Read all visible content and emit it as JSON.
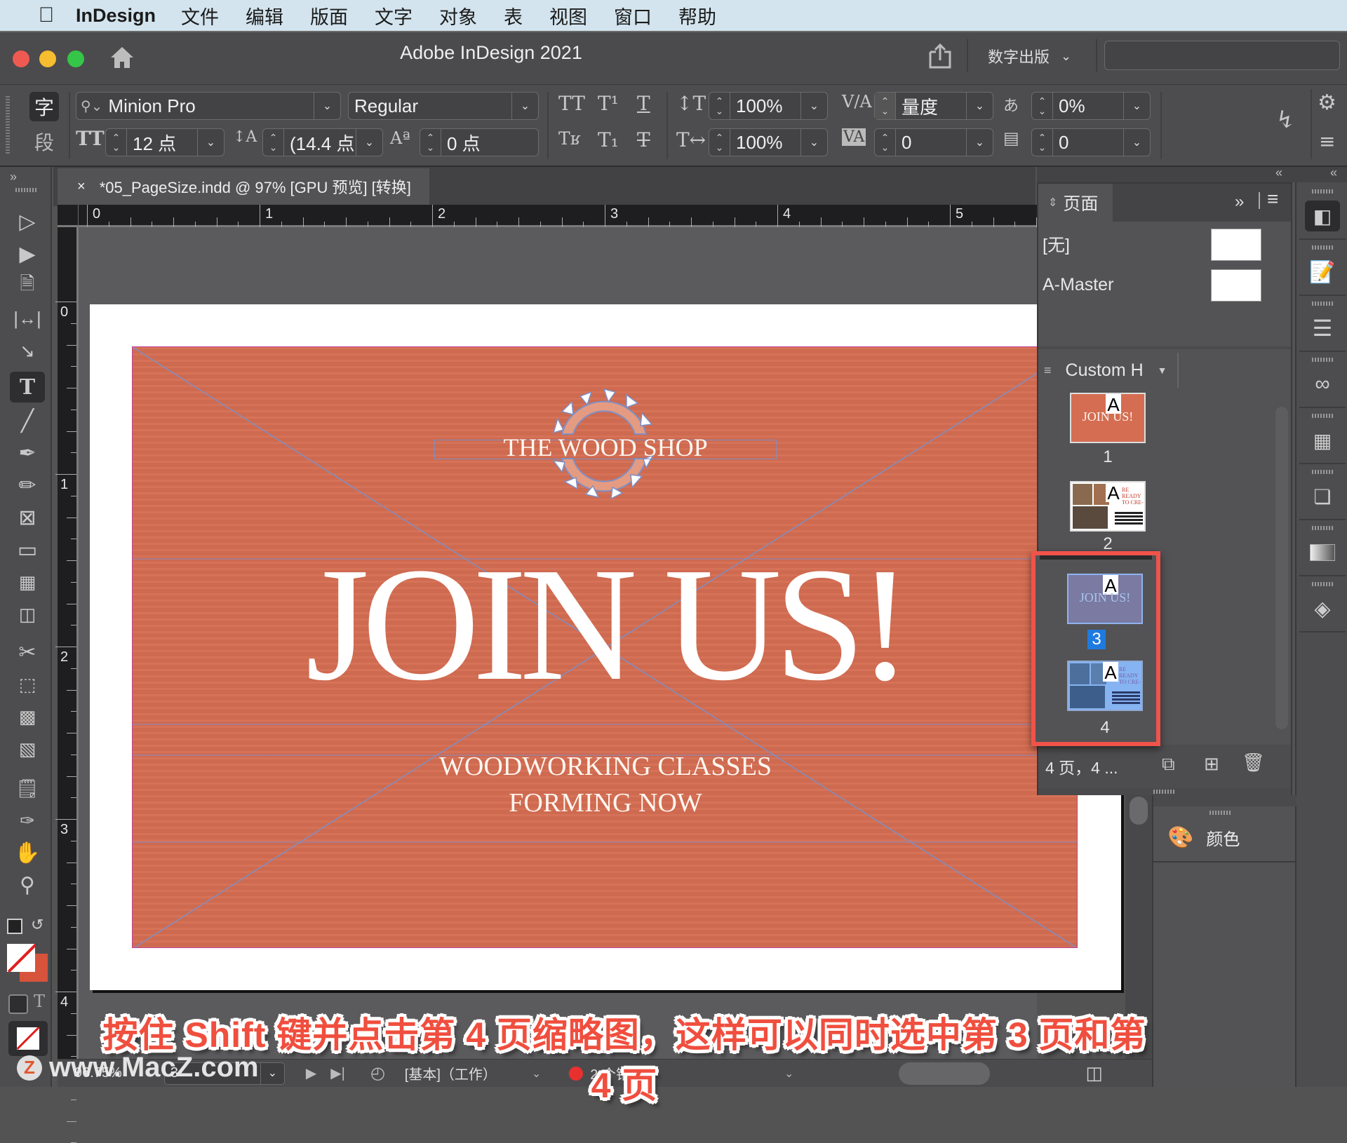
{
  "menubar": {
    "app_name": "InDesign",
    "items": [
      "文件",
      "编辑",
      "版面",
      "文字",
      "对象",
      "表",
      "视图",
      "窗口",
      "帮助"
    ]
  },
  "window": {
    "title": "Adobe InDesign 2021",
    "workspace": "数字出版",
    "search_placeholder": ""
  },
  "controlbar": {
    "mode_char": "字",
    "mode_para": "段",
    "font_family": "Minion Pro",
    "font_style": "Regular",
    "font_size": "12 点",
    "leading": "(14.4 点",
    "baseline_shift": "0 点",
    "vertical_scale": "100%",
    "horizontal_scale": "100%",
    "kerning": "量度",
    "tracking": "0",
    "tsume": "0%",
    "grid_count": "0"
  },
  "document": {
    "tab_title": "*05_PageSize.indd @ 97% [GPU 预览] [转换]",
    "close_glyph": "×",
    "hruler_labels": [
      "0",
      "1",
      "2",
      "3",
      "4",
      "5"
    ],
    "vruler_labels": [
      "0",
      "1",
      "2",
      "3",
      "4"
    ],
    "artwork": {
      "logo_text": "THE WOOD SHOP",
      "headline": "JOIN US!",
      "sub_line1": "WOODWORKING CLASSES",
      "sub_line2": "FORMING NOW",
      "bg_color": "#d56d52"
    }
  },
  "pages_panel": {
    "tab_label": "页面",
    "masters": [
      {
        "label": "[无]"
      },
      {
        "label": "A-Master"
      }
    ],
    "size_select": "Custom H",
    "pages": [
      {
        "number": "1",
        "master": "A",
        "content": "JOIN US!",
        "selected": false
      },
      {
        "number": "2",
        "master": "A",
        "content": "RE READY TO CRE-",
        "selected": false
      },
      {
        "number": "3",
        "master": "A",
        "content": "JOIN US!",
        "selected": true
      },
      {
        "number": "4",
        "master": "A",
        "content": "RE READY TO CRE-",
        "selected": true
      }
    ],
    "footer_status": "4 页，4 ...",
    "highlight_color": "#f0534a"
  },
  "color_panel": {
    "label": "颜色"
  },
  "status_bar": {
    "zoom": "96.75%",
    "page_field": "3",
    "preflight_profile": "[基本]（工作）",
    "errors": "2 个错误",
    "error_color": "#e8312f"
  },
  "caption": "按住 Shift 键并点击第 4 页缩略图，这样可以同时选中第 3 页和第 4 页",
  "watermark": "www.MacZ.com"
}
